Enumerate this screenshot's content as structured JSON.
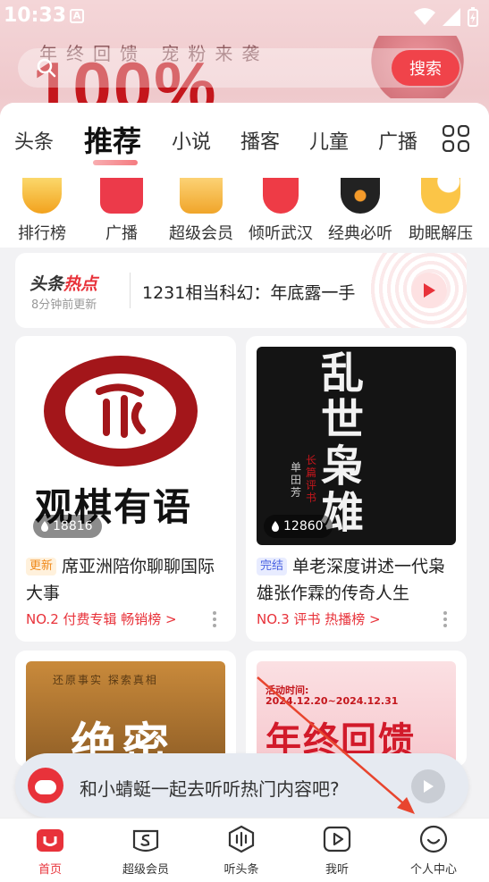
{
  "status_bar": {
    "time": "10:33",
    "app_badge": "A"
  },
  "banner": {
    "promo_text": "年终回馈 宠粉来袭",
    "big_text": "100%"
  },
  "search": {
    "button_label": "搜索"
  },
  "tabs": [
    {
      "label": "头条",
      "active": false
    },
    {
      "label": "推荐",
      "active": true
    },
    {
      "label": "小说",
      "active": false
    },
    {
      "label": "播客",
      "active": false
    },
    {
      "label": "儿童",
      "active": false
    },
    {
      "label": "广播",
      "active": false
    }
  ],
  "quick_entries": [
    {
      "label": "排行榜",
      "icon": "trophy-icon"
    },
    {
      "label": "广播",
      "icon": "radio-icon"
    },
    {
      "label": "超级会员",
      "icon": "crown-icon"
    },
    {
      "label": "倾听武汉",
      "icon": "location-pin-icon"
    },
    {
      "label": "经典必听",
      "icon": "vinyl-record-icon"
    },
    {
      "label": "助眠解压",
      "icon": "moon-icon"
    }
  ],
  "hot": {
    "logo_a": "头条",
    "logo_b": "热点",
    "updated": "8分钟前更新",
    "title": "1231相当科幻：年底露一手"
  },
  "cards": [
    {
      "cover_text": "观棋有语",
      "seal_text": "将",
      "plays": "18816",
      "tag": "更新",
      "title": "席亚洲陪你聊聊国际大事",
      "rank": "NO.2 付费专辑 畅销榜 >"
    },
    {
      "cover_text": "乱世枭雄",
      "cover_side": "长篇评书",
      "cover_author": "单田芳",
      "plays": "12860",
      "tag": "完结",
      "title": "单老深度讲述一代枭雄张作霖的传奇人生",
      "rank": "NO.3 评书 热播榜 >"
    },
    {
      "cover_top": "还原事实 探索真相",
      "cover_text": "绝密"
    },
    {
      "cover_top": "活动时间:",
      "cover_date": "2024.12.20~2024.12.31",
      "cover_text": "年终回馈"
    }
  ],
  "voice_bar": {
    "text": "和小蜻蜓一起去听听热门内容吧?"
  },
  "bottom_nav": [
    {
      "label": "首页",
      "active": true
    },
    {
      "label": "超级会员",
      "active": false
    },
    {
      "label": "听头条",
      "active": false
    },
    {
      "label": "我听",
      "active": false
    },
    {
      "label": "个人中心",
      "active": false
    }
  ],
  "colors": {
    "accent": "#e8323a",
    "search_button": "#f0434a"
  }
}
